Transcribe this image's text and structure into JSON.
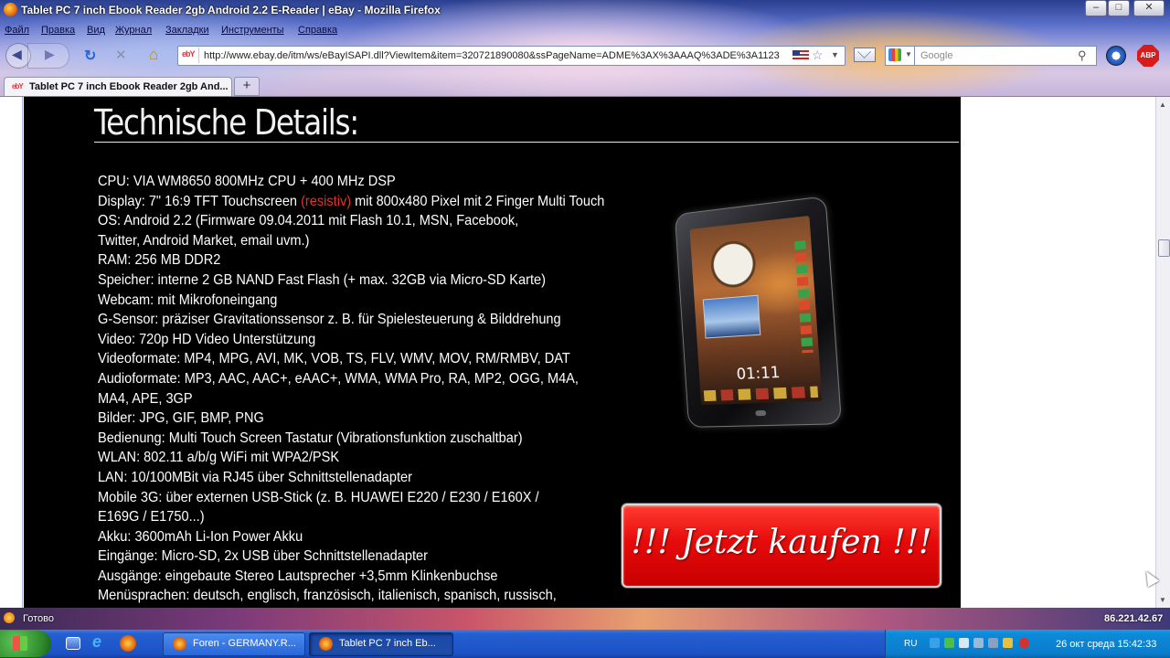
{
  "window": {
    "title": "Tablet PC 7 inch Ebook Reader 2gb Android 2.2 E-Reader | eBay - Mozilla Firefox",
    "minimize": "–",
    "maximize": "□",
    "close": "✕"
  },
  "menu": [
    "Файл",
    "Правка",
    "Вид",
    "Журнал",
    "Закладки",
    "Инструменты",
    "Справка"
  ],
  "navigation": {
    "url": "http://www.ebay.de/itm/ws/eBayISAPI.dll?ViewItem&item=320721890080&ssPageName=ADME%3AX%3AAAQ%3ADE%3A1123",
    "favicon_text": "ebY",
    "search_placeholder": "Google",
    "adblock_label": "ABP",
    "icons": [
      "back-arrow-icon",
      "forward-arrow-icon",
      "reload-icon",
      "stop-icon",
      "home-icon",
      "bookmark-star-icon",
      "mail-icon",
      "google-icon",
      "search-icon"
    ]
  },
  "tabs": [
    {
      "label": "Tablet PC 7 inch Ebook Reader 2gb And...",
      "active": true
    }
  ],
  "new_tab_label": "+",
  "content": {
    "section_title": "Technische Details:",
    "specs": [
      "CPU: VIA WM8650 800MHz CPU + 400 MHz DSP",
      {
        "before": "Display: 7\" 16:9 TFT Touchscreen ",
        "highlight": "(resistiv)",
        "after": " mit 800x480 Pixel mit 2 Finger Multi Touch"
      },
      "OS: Android 2.2 (Firmware 09.04.2011 mit Flash 10.1, MSN, Facebook,",
      "Twitter, Android Market, email uvm.)",
      "RAM: 256 MB DDR2",
      "Speicher: interne 2 GB NAND Fast Flash (+ max. 32GB via Micro-SD Karte)",
      "Webcam: mit Mikrofoneingang",
      "G-Sensor: präziser Gravitationssensor z. B. für Spielesteuerung & Bilddrehung",
      "Video: 720p HD Video Unterstützung",
      "Videoformate: MP4, MPG, AVI, MK, VOB, TS, FLV, WMV, MOV, RM/RMBV, DAT",
      "Audioformate: MP3, AAC, AAC+, eAAC+, WMA, WMA Pro, RA, MP2, OGG, M4A,",
      "MA4, APE, 3GP",
      "Bilder: JPG, GIF, BMP, PNG",
      "Bedienung: Multi Touch Screen Tastatur (Vibrationsfunktion zuschaltbar)",
      "WLAN: 802.11 a/b/g WiFi mit WPA2/PSK",
      "LAN: 10/100MBit via RJ45 über Schnittstellenadapter",
      "Mobile 3G: über externen USB-Stick (z. B. HUAWEI E220 / E230 / E160X /",
      "E169G / E1750...)",
      "Akku: 3600mAh Li-Ion Power Akku",
      "Eingänge: Micro-SD, 2x USB über Schnittstellenadapter",
      "Ausgänge: eingebaute Stereo Lautsprecher +3,5mm Klinkenbuchse",
      "Menüsprachen: deutsch, englisch, französisch, italienisch, spanisch, russisch,"
    ],
    "tablet_screen_time": "01:11",
    "buy_button": "!!! Jetzt kaufen !!!",
    "colors": {
      "panel": "#000000",
      "highlight": "#e0342a",
      "buy_button": "#e60b0b"
    }
  },
  "status": {
    "text": "Готово",
    "ip": "86.221.42.67"
  },
  "taskbar": {
    "tasks": [
      {
        "label": "Foren - GERMANY.R...",
        "active": false
      },
      {
        "label": "Tablet PC 7 inch Eb...",
        "active": true
      }
    ],
    "language": "RU",
    "clock": "26 окт среда 15:42:33"
  }
}
